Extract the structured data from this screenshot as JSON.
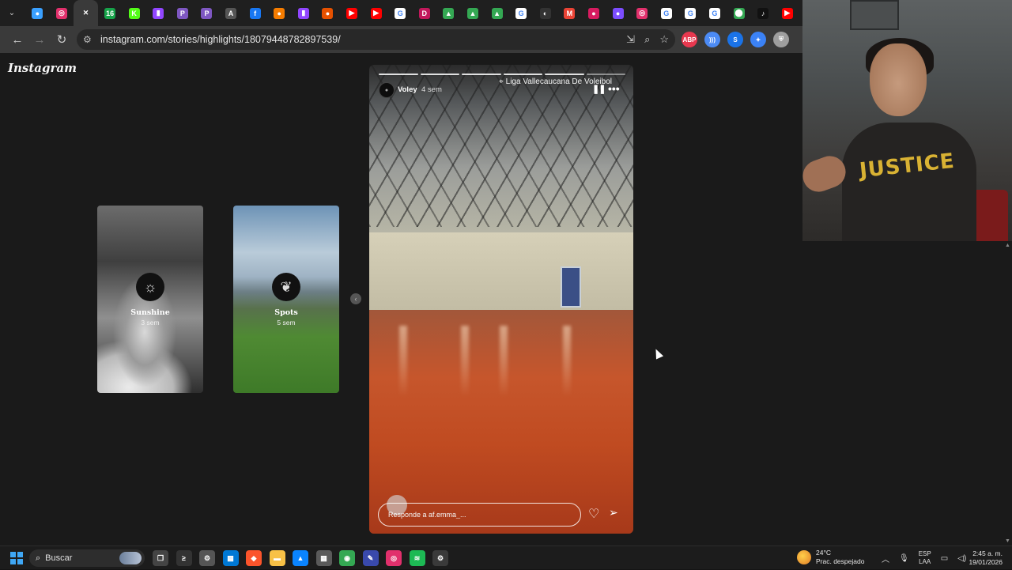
{
  "browser": {
    "url": "instagram.com/stories/highlights/18079448782897539/",
    "tabs": [
      {
        "icon": "dot-icon",
        "color": "#3aa0ff",
        "label": "●"
      },
      {
        "icon": "instagram-icon",
        "color": "#e1306c",
        "label": "◎"
      },
      {
        "icon": "close-icon",
        "color": "#3a3a3a",
        "label": "✕",
        "active": true
      },
      {
        "icon": "counter-icon",
        "color": "#17a34a",
        "label": "16"
      },
      {
        "icon": "kick-icon",
        "color": "#53fc18",
        "label": "K"
      },
      {
        "icon": "twitch-icon",
        "color": "#9146ff",
        "label": "▮"
      },
      {
        "icon": "podcast-icon",
        "color": "#7e57c2",
        "label": "P"
      },
      {
        "icon": "podcast-icon",
        "color": "#7e57c2",
        "label": "P"
      },
      {
        "icon": "letter-a-icon",
        "color": "#555555",
        "label": "A"
      },
      {
        "icon": "facebook-icon",
        "color": "#1877f2",
        "label": "f"
      },
      {
        "icon": "orange-app-icon",
        "color": "#f57c00",
        "label": "●"
      },
      {
        "icon": "twitch-icon",
        "color": "#9146ff",
        "label": "▮"
      },
      {
        "icon": "fox-icon",
        "color": "#e65100",
        "label": "●"
      },
      {
        "icon": "youtube-icon",
        "color": "#ff0000",
        "label": "▶"
      },
      {
        "icon": "youtube-icon",
        "color": "#ff0000",
        "label": "▶"
      },
      {
        "icon": "google-icon",
        "color": "#ffffff",
        "label": "G"
      },
      {
        "icon": "d-icon",
        "color": "#c2185b",
        "label": "D"
      },
      {
        "icon": "drive-icon",
        "color": "#34a853",
        "label": "▲"
      },
      {
        "icon": "drive-icon",
        "color": "#34a853",
        "label": "▲"
      },
      {
        "icon": "drive-icon",
        "color": "#34a853",
        "label": "▲"
      },
      {
        "icon": "google-icon",
        "color": "#ffffff",
        "label": "G"
      },
      {
        "icon": "github-icon",
        "color": "#333333",
        "label": "◐"
      },
      {
        "icon": "gmail-icon",
        "color": "#ea4335",
        "label": "M"
      },
      {
        "icon": "red-app-icon",
        "color": "#d81b60",
        "label": "●"
      },
      {
        "icon": "purple-app-icon",
        "color": "#7c4dff",
        "label": "●"
      },
      {
        "icon": "instagram-icon",
        "color": "#e1306c",
        "label": "◎"
      },
      {
        "icon": "google-icon",
        "color": "#ffffff",
        "label": "G"
      },
      {
        "icon": "google-icon",
        "color": "#ffffff",
        "label": "G"
      },
      {
        "icon": "google-icon",
        "color": "#ffffff",
        "label": "G"
      },
      {
        "icon": "maps-icon",
        "color": "#34a853",
        "label": "⬤"
      },
      {
        "icon": "tiktok-icon",
        "color": "#111111",
        "label": "♪"
      },
      {
        "icon": "youtube-icon",
        "color": "#ff0000",
        "label": "▶"
      }
    ],
    "extensions": [
      {
        "icon": "abp-icon",
        "color": "#e8384f",
        "label": "ABP"
      },
      {
        "icon": "sound-icon",
        "color": "#4c8bf5",
        "label": ")))"
      },
      {
        "icon": "shazam-icon",
        "color": "#1a73e8",
        "label": "S"
      },
      {
        "icon": "puzzle-icon",
        "color": "#3b82f6",
        "label": "✦"
      },
      {
        "icon": "shield-icon",
        "color": "#9e9e9e",
        "label": "⛨"
      }
    ]
  },
  "instagram": {
    "logo": "Instagram",
    "highlights": [
      {
        "name": "Sunshine",
        "time": "3 sem",
        "icon": "sun-icon",
        "glyph": "☼"
      },
      {
        "name": "Spots",
        "time": "5 sem",
        "icon": "leaf-icon",
        "glyph": "❦"
      }
    ],
    "story": {
      "user": "Voley",
      "age": "4 sem",
      "location": "Liga Vallecaucana De Voleibol",
      "segments": 6,
      "reply_placeholder": "Responde a af.emma_..."
    }
  },
  "taskbar": {
    "search_label": "Buscar",
    "apps": [
      {
        "icon": "task-view-icon",
        "color": "#444444",
        "label": "❐"
      },
      {
        "icon": "terminal-icon",
        "color": "#333333",
        "label": "≥"
      },
      {
        "icon": "settings-icon",
        "color": "#555555",
        "label": "⚙"
      },
      {
        "icon": "store-icon",
        "color": "#0078d4",
        "label": "▦"
      },
      {
        "icon": "brave-icon",
        "color": "#fb542b",
        "label": "◆"
      },
      {
        "icon": "folder-icon",
        "color": "#f8c146",
        "label": "▬"
      },
      {
        "icon": "photos-icon",
        "color": "#0a84ff",
        "label": "▲"
      },
      {
        "icon": "calculator-icon",
        "color": "#5a5a5a",
        "label": "▦"
      },
      {
        "icon": "chrome-icon",
        "color": "#34a853",
        "label": "◉"
      },
      {
        "icon": "editor-icon",
        "color": "#3949ab",
        "label": "✎"
      },
      {
        "icon": "instagram-icon",
        "color": "#e1306c",
        "label": "◎"
      },
      {
        "icon": "spotify-icon",
        "color": "#1db954",
        "label": "≋"
      },
      {
        "icon": "gear-icon",
        "color": "#3a3a3a",
        "label": "⚙"
      }
    ],
    "weather": {
      "temp": "24°C",
      "desc": "Prac. despejado"
    },
    "language": {
      "line1": "ESP",
      "line2": "LAA"
    },
    "time": "2:45 a. m.",
    "date": "19/01/2026"
  },
  "webcam": {
    "shirt_text": "JUSTICE"
  }
}
